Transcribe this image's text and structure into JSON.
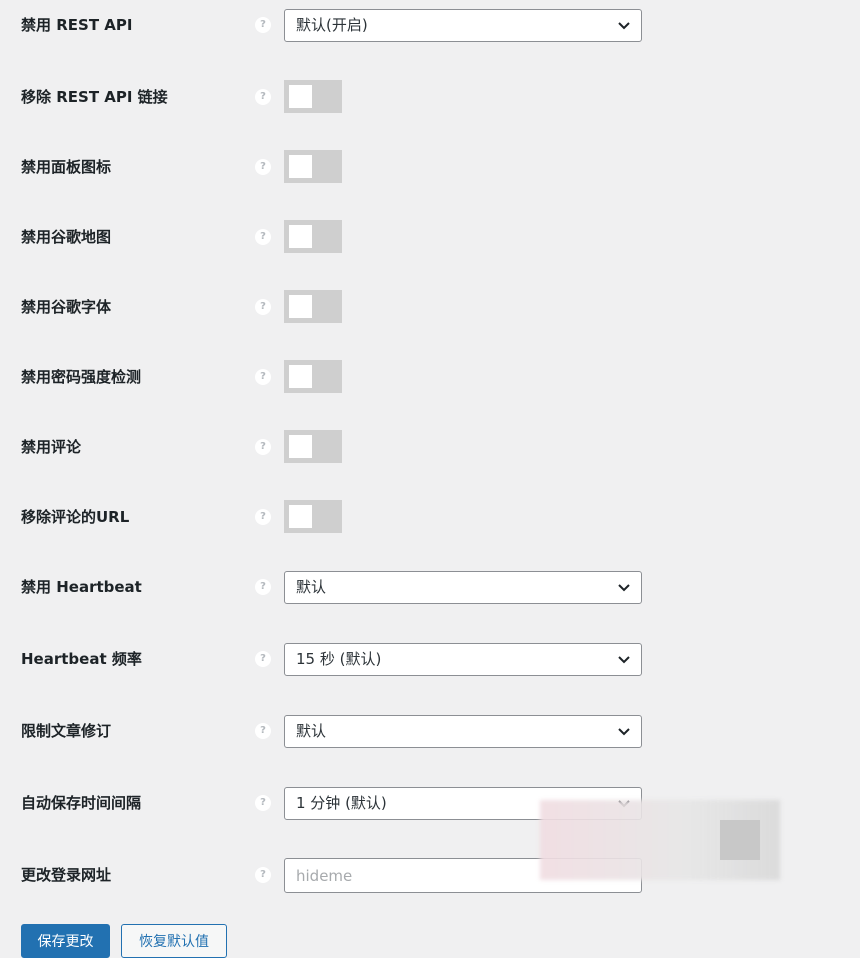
{
  "help_glyph": "?",
  "settings": [
    {
      "label": "禁用 REST API",
      "control": "select",
      "value": "默认(开启)"
    },
    {
      "label": "移除 REST API 链接",
      "control": "toggle",
      "checked": false
    },
    {
      "label": "禁用面板图标",
      "control": "toggle",
      "checked": false
    },
    {
      "label": "禁用谷歌地图",
      "control": "toggle",
      "checked": false
    },
    {
      "label": "禁用谷歌字体",
      "control": "toggle",
      "checked": false
    },
    {
      "label": "禁用密码强度检测",
      "control": "toggle",
      "checked": false
    },
    {
      "label": "禁用评论",
      "control": "toggle",
      "checked": false
    },
    {
      "label": "移除评论的URL",
      "control": "toggle",
      "checked": false
    },
    {
      "label": "禁用 Heartbeat",
      "control": "select",
      "value": "默认"
    },
    {
      "label": "Heartbeat 频率",
      "control": "select",
      "value": "15 秒 (默认)"
    },
    {
      "label": "限制文章修订",
      "control": "select",
      "value": "默认"
    },
    {
      "label": "自动保存时间间隔",
      "control": "select",
      "value": "1 分钟 (默认)"
    },
    {
      "label": "更改登录网址",
      "control": "text",
      "value": "",
      "placeholder": "hideme"
    }
  ],
  "buttons": {
    "save": "保存更改",
    "reset": "恢复默认值"
  },
  "colors": {
    "background": "#f0f0f1",
    "primary": "#2271b1",
    "toggle_off": "#cfcfcf"
  }
}
